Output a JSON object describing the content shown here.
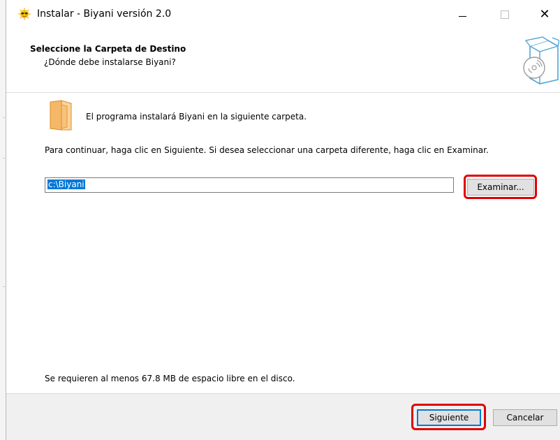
{
  "window": {
    "title": "Instalar - Biyani versión 2.0",
    "icons": {
      "app": "sun-glasses-icon",
      "minimize": "minimize-icon",
      "maximize": "maximize-icon",
      "close": "close-icon"
    },
    "close_glyph": "✕"
  },
  "header": {
    "title": "Seleccione la Carpeta de Destino",
    "subtitle": "¿Dónde debe instalarse Biyani?",
    "icon": "install-box-disc-icon"
  },
  "body": {
    "folder_icon": "folder-icon",
    "intro": "El programa instalará Biyani en la siguiente carpeta.",
    "instruction": "Para continuar, haga clic en Siguiente. Si desea seleccionar una carpeta diferente, haga clic en Examinar.",
    "path_value": "c:\\Biyani",
    "browse_label": "Examinar...",
    "space_required": "Se requieren al menos 67.8 MB de espacio libre en el disco."
  },
  "footer": {
    "next_label": "Siguiente",
    "cancel_label": "Cancelar"
  },
  "colors": {
    "highlight": "#e00000",
    "selection": "#0078d7",
    "button_face": "#e1e1e1",
    "footer_bg": "#f0f0f0"
  }
}
